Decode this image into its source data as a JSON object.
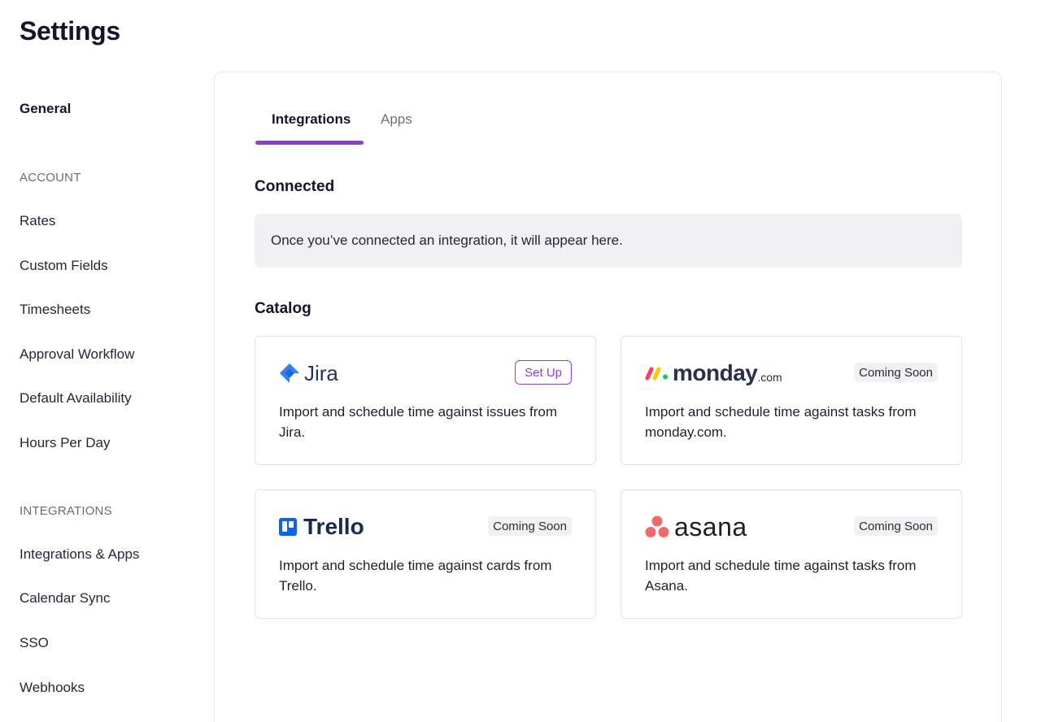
{
  "page": {
    "title": "Settings"
  },
  "sidebar": {
    "general": "General",
    "sections": [
      {
        "label": "ACCOUNT",
        "items": [
          "Rates",
          "Custom Fields",
          "Timesheets",
          "Approval Workflow",
          "Default Availability",
          "Hours Per Day"
        ]
      },
      {
        "label": "INTEGRATIONS",
        "items": [
          "Integrations & Apps",
          "Calendar Sync",
          "SSO",
          "Webhooks"
        ]
      }
    ]
  },
  "tabs": [
    {
      "label": "Integrations",
      "active": true
    },
    {
      "label": "Apps",
      "active": false
    }
  ],
  "connected": {
    "heading": "Connected",
    "empty_message": "Once you’ve connected an integration, it will appear here."
  },
  "catalog": {
    "heading": "Catalog",
    "cards": [
      {
        "name": "Jira",
        "logo_text": "Jira",
        "logo_icon": "jira-icon",
        "action": "Set Up",
        "description": "Import and schedule time against issues from Jira."
      },
      {
        "name": "monday.com",
        "logo_text": "monday",
        "logo_suffix": ".com",
        "logo_icon": "monday-icon",
        "status": "Coming Soon",
        "description": "Import and schedule time against tasks from monday.com."
      },
      {
        "name": "Trello",
        "logo_text": "Trello",
        "logo_icon": "trello-icon",
        "status": "Coming Soon",
        "description": "Import and schedule time against cards from Trello."
      },
      {
        "name": "Asana",
        "logo_text": "asana",
        "logo_icon": "asana-icon",
        "status": "Coming Soon",
        "description": "Import and schedule time against tasks from Asana."
      }
    ]
  },
  "colors": {
    "accent": "#8e3fc9",
    "jira_blue": "#2684ff",
    "trello_blue": "#0c66e4",
    "asana_coral": "#f06a6a",
    "monday_red": "#ff3d57",
    "monday_yellow": "#ffcb00",
    "monday_green": "#00d647"
  }
}
